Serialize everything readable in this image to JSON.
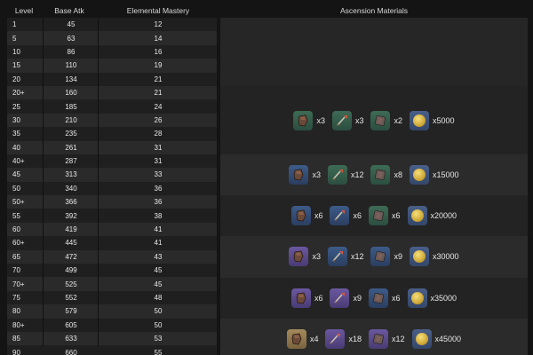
{
  "headers": {
    "level": "Level",
    "base_atk": "Base Atk",
    "elemental_mastery": "Elemental Mastery",
    "ascension_materials": "Ascension Materials"
  },
  "rows": [
    {
      "level": "1",
      "atk": "45",
      "em": "12"
    },
    {
      "level": "5",
      "atk": "63",
      "em": "14"
    },
    {
      "level": "10",
      "atk": "86",
      "em": "16"
    },
    {
      "level": "15",
      "atk": "110",
      "em": "19"
    },
    {
      "level": "20",
      "atk": "134",
      "em": "21"
    },
    {
      "level": "20+",
      "atk": "160",
      "em": "21"
    },
    {
      "level": "25",
      "atk": "185",
      "em": "24"
    },
    {
      "level": "30",
      "atk": "210",
      "em": "26"
    },
    {
      "level": "35",
      "atk": "235",
      "em": "28"
    },
    {
      "level": "40",
      "atk": "261",
      "em": "31"
    },
    {
      "level": "40+",
      "atk": "287",
      "em": "31"
    },
    {
      "level": "45",
      "atk": "313",
      "em": "33"
    },
    {
      "level": "50",
      "atk": "340",
      "em": "36"
    },
    {
      "level": "50+",
      "atk": "366",
      "em": "36"
    },
    {
      "level": "55",
      "atk": "392",
      "em": "38"
    },
    {
      "level": "60",
      "atk": "419",
      "em": "41"
    },
    {
      "level": "60+",
      "atk": "445",
      "em": "41"
    },
    {
      "level": "65",
      "atk": "472",
      "em": "43"
    },
    {
      "level": "70",
      "atk": "499",
      "em": "45"
    },
    {
      "level": "70+",
      "atk": "525",
      "em": "45"
    },
    {
      "level": "75",
      "atk": "552",
      "em": "48"
    },
    {
      "level": "80",
      "atk": "579",
      "em": "50"
    },
    {
      "level": "80+",
      "atk": "605",
      "em": "50"
    },
    {
      "level": "85",
      "atk": "633",
      "em": "53"
    },
    {
      "level": "90",
      "atk": "660",
      "em": "55"
    }
  ],
  "ascensions": [
    {
      "stage": "20+",
      "materials": [
        {
          "icon": "chunk-icon",
          "rarity": "green",
          "qty": "x3"
        },
        {
          "icon": "arrowhead-icon",
          "rarity": "green",
          "qty": "x3"
        },
        {
          "icon": "tablet-icon",
          "rarity": "green",
          "qty": "x2"
        },
        {
          "icon": "mora-coin-icon",
          "rarity": "coin",
          "qty": "x5000"
        }
      ]
    },
    {
      "stage": "40+",
      "materials": [
        {
          "icon": "chunk-icon",
          "rarity": "blue",
          "qty": "x3"
        },
        {
          "icon": "arrowhead-icon",
          "rarity": "green",
          "qty": "x12"
        },
        {
          "icon": "tablet-icon",
          "rarity": "green",
          "qty": "x8"
        },
        {
          "icon": "mora-coin-icon",
          "rarity": "coin",
          "qty": "x15000"
        }
      ]
    },
    {
      "stage": "50+",
      "materials": [
        {
          "icon": "chunk-icon",
          "rarity": "blue",
          "qty": "x6"
        },
        {
          "icon": "arrowhead-icon",
          "rarity": "blue",
          "qty": "x6"
        },
        {
          "icon": "tablet-icon",
          "rarity": "green",
          "qty": "x6"
        },
        {
          "icon": "mora-coin-icon",
          "rarity": "coin",
          "qty": "x20000"
        }
      ]
    },
    {
      "stage": "60+",
      "materials": [
        {
          "icon": "chunk-icon",
          "rarity": "purple",
          "qty": "x3"
        },
        {
          "icon": "arrowhead-icon",
          "rarity": "blue",
          "qty": "x12"
        },
        {
          "icon": "tablet-icon",
          "rarity": "blue",
          "qty": "x9"
        },
        {
          "icon": "mora-coin-icon",
          "rarity": "coin",
          "qty": "x30000"
        }
      ]
    },
    {
      "stage": "70+",
      "materials": [
        {
          "icon": "chunk-icon",
          "rarity": "purple",
          "qty": "x6"
        },
        {
          "icon": "arrowhead-icon",
          "rarity": "purple",
          "qty": "x9"
        },
        {
          "icon": "tablet-icon",
          "rarity": "blue",
          "qty": "x6"
        },
        {
          "icon": "mora-coin-icon",
          "rarity": "coin",
          "qty": "x35000"
        }
      ]
    },
    {
      "stage": "80+",
      "materials": [
        {
          "icon": "chunk-icon",
          "rarity": "gold",
          "qty": "x4"
        },
        {
          "icon": "arrowhead-icon",
          "rarity": "purple",
          "qty": "x18"
        },
        {
          "icon": "tablet-icon",
          "rarity": "purple",
          "qty": "x12"
        },
        {
          "icon": "mora-coin-icon",
          "rarity": "coin",
          "qty": "x45000"
        }
      ]
    }
  ]
}
